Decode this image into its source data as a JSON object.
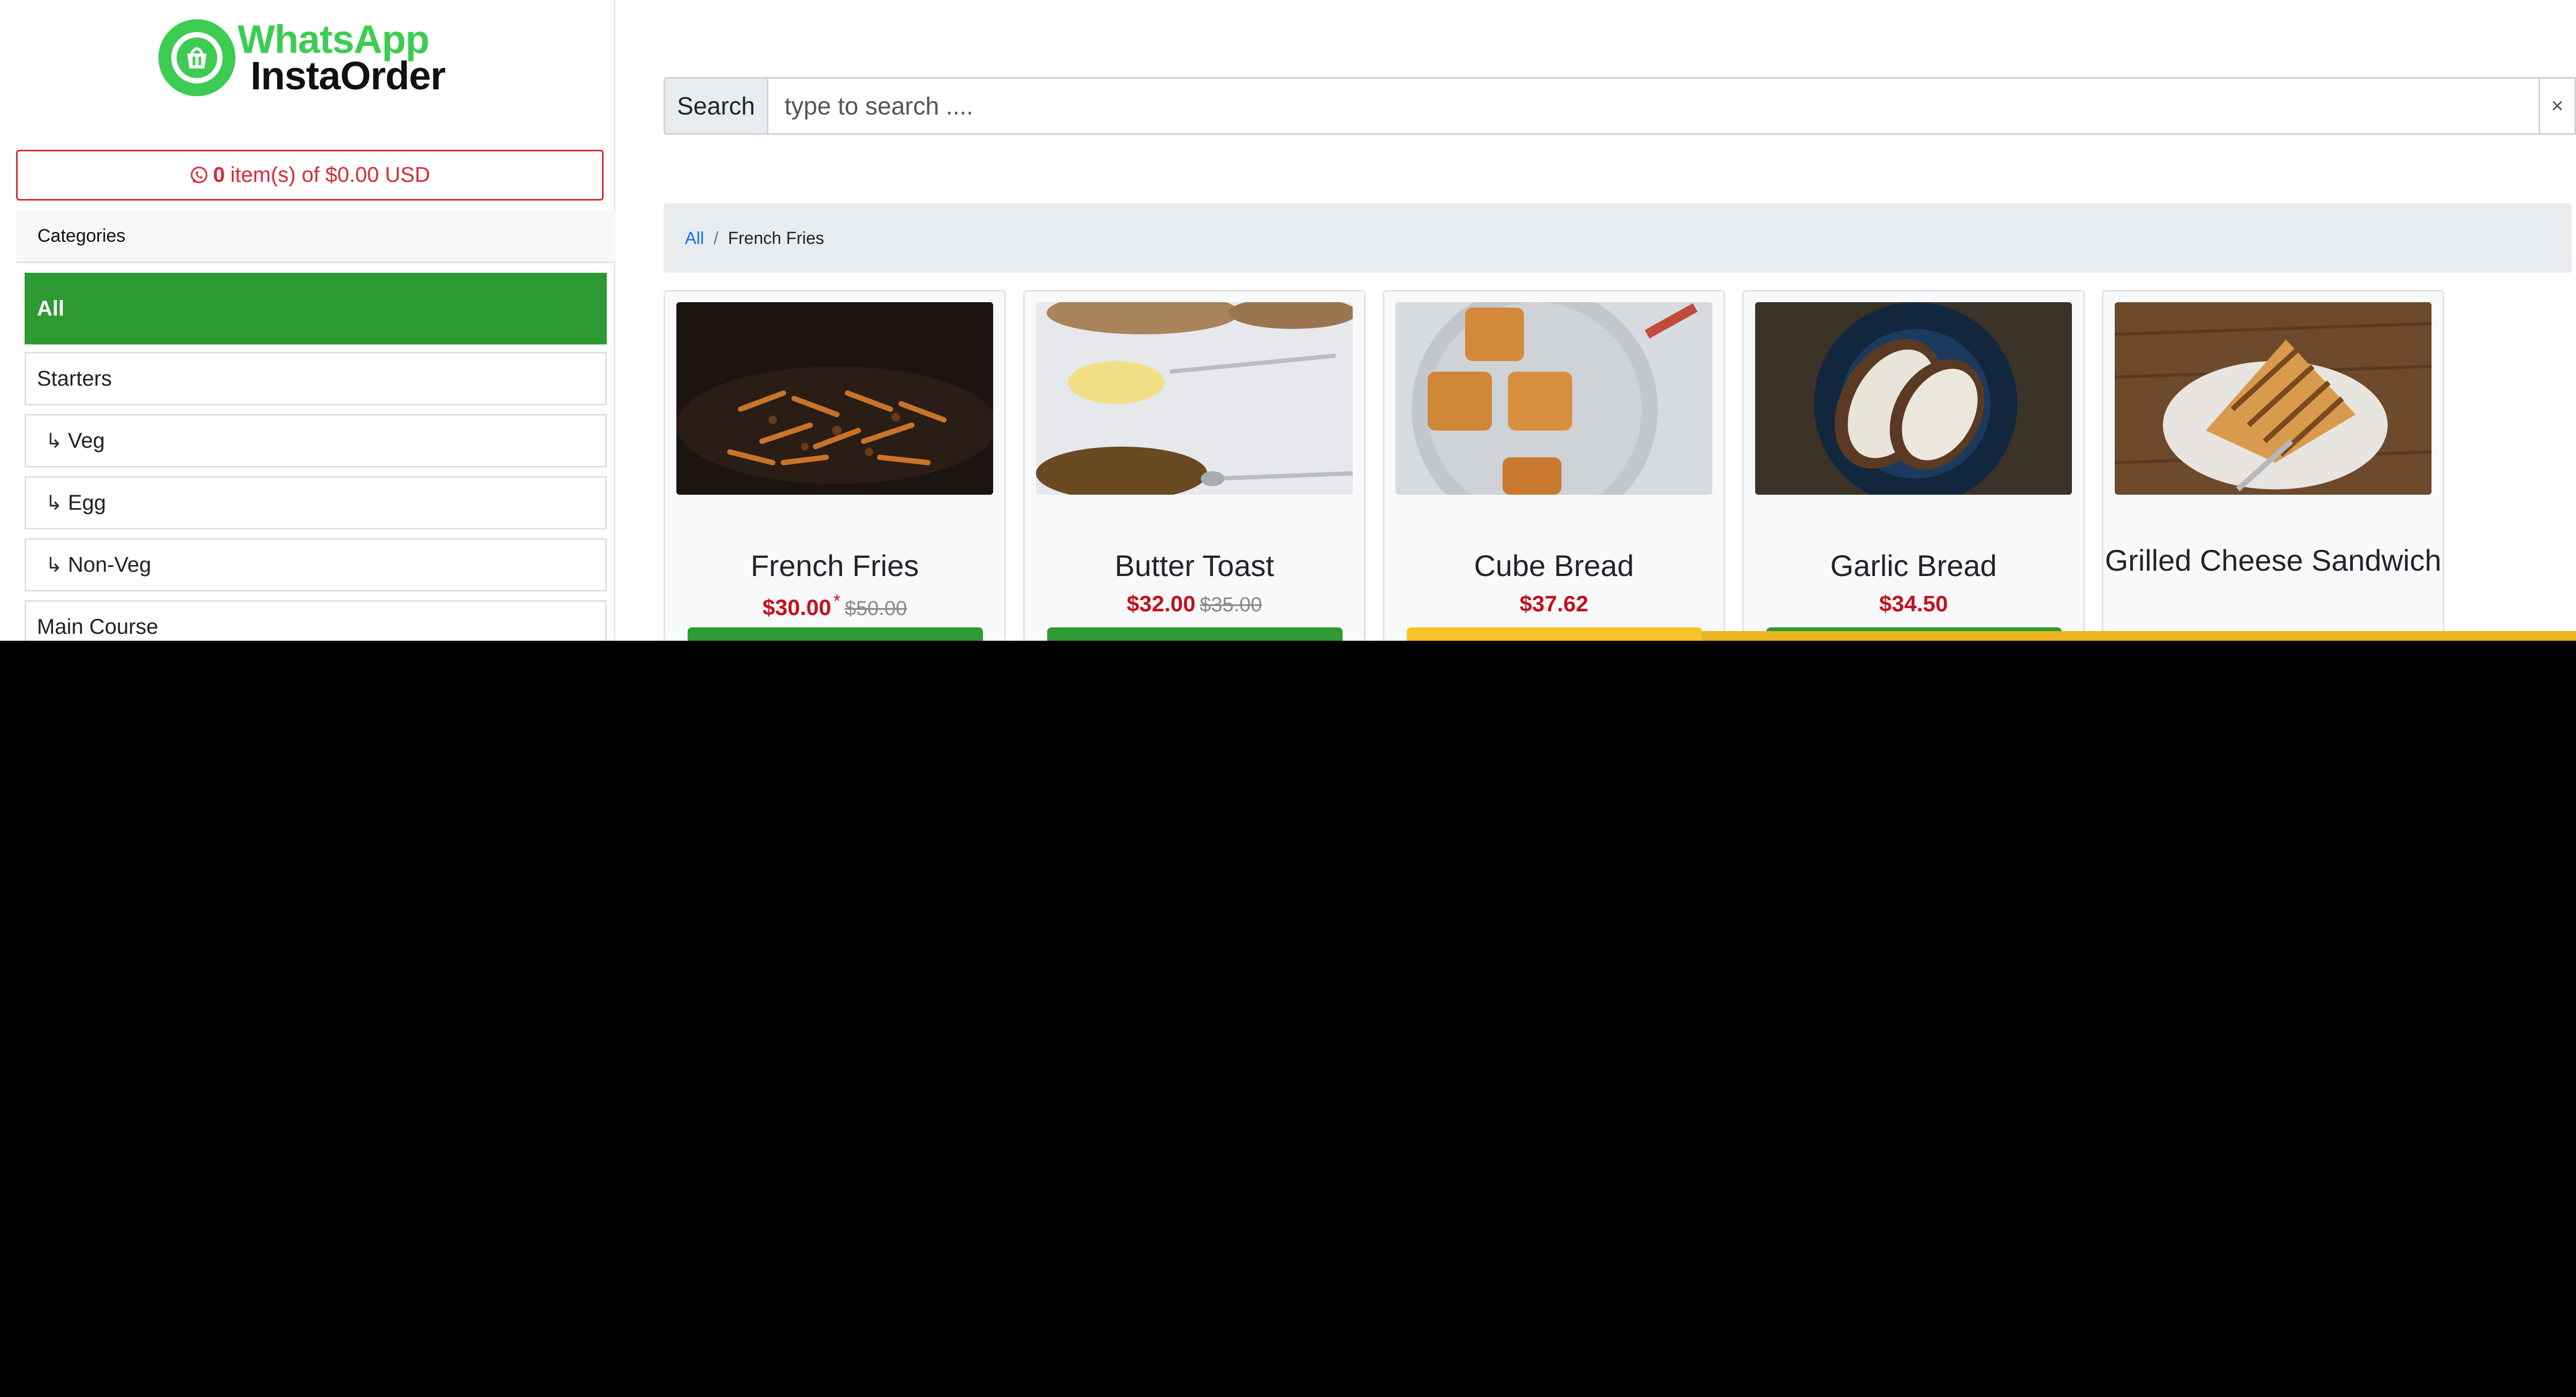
{
  "brand": {
    "line1": "WhatsApp",
    "line2": "InstaOrder",
    "icon": "whatsapp-basket-icon"
  },
  "cart": {
    "icon": "whatsapp-icon",
    "count": "0",
    "text": "item(s) of $0.00 USD"
  },
  "sidebar": {
    "header": "Categories",
    "items": [
      {
        "label": "All",
        "active": true,
        "sub": false
      },
      {
        "label": "Starters",
        "active": false,
        "sub": false
      },
      {
        "label": "Veg",
        "active": false,
        "sub": true
      },
      {
        "label": "Egg",
        "active": false,
        "sub": true
      },
      {
        "label": "Non-Veg",
        "active": false,
        "sub": true
      },
      {
        "label": "Main Course",
        "active": false,
        "sub": false
      }
    ]
  },
  "search": {
    "label": "Search",
    "placeholder": "type to search ....",
    "clear": "×"
  },
  "breadcrumb": {
    "root": "All",
    "separator": "/",
    "current": "French Fries"
  },
  "products": [
    {
      "name": "French Fries",
      "price": "$30.00",
      "star": "*",
      "old_price": "$50.00",
      "button_color": "green",
      "image": "fries-photo"
    },
    {
      "name": "Butter Toast",
      "price": "$32.00",
      "old_price": "$35.00",
      "button_color": "green",
      "image": "toast-photo"
    },
    {
      "name": "Cube Bread",
      "price": "$37.62",
      "button_color": "yellow",
      "image": "cube-bread-photo"
    },
    {
      "name": "Garlic Bread",
      "price": "$34.50",
      "button_color": "green",
      "image": "garlic-bread-photo"
    },
    {
      "name": "Grilled Cheese Sandwich",
      "image": "sandwich-photo"
    }
  ],
  "colors": {
    "brand_green": "#3dcc52",
    "active_green": "#2e9a33",
    "price_red": "#c4101e",
    "cart_red": "#d62b3b",
    "yellow": "#f6c227"
  }
}
